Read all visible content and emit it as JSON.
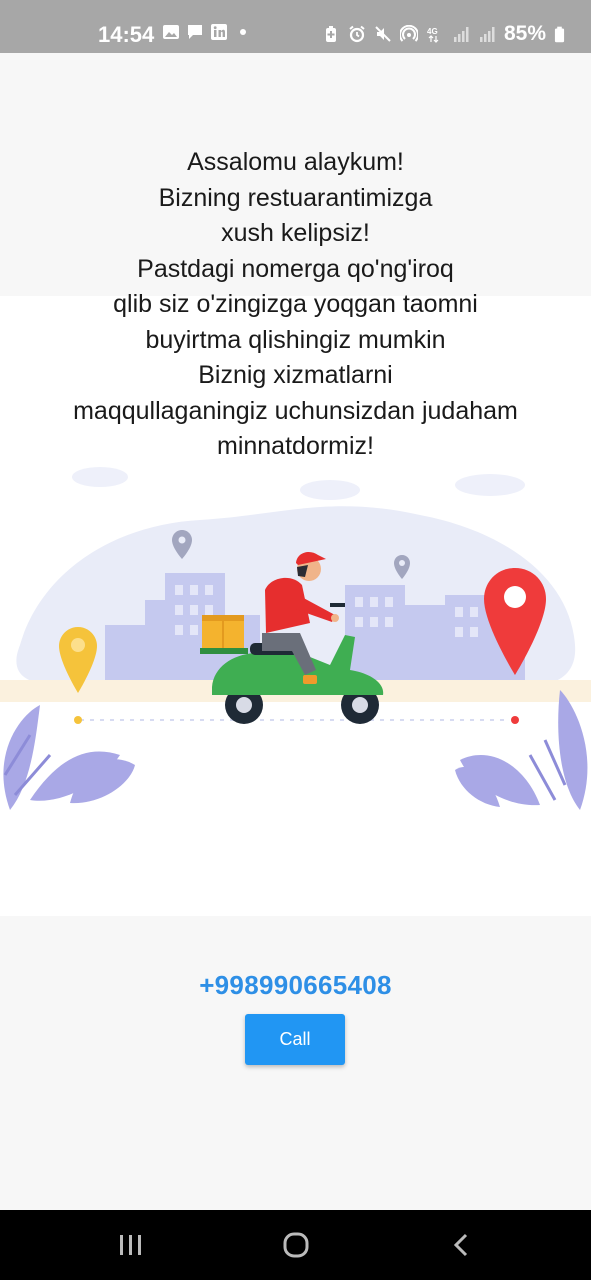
{
  "status_bar": {
    "time": "14:54",
    "battery": "85%",
    "left_icons": [
      "image-icon",
      "chat-icon",
      "linkedin-icon",
      "dot-icon"
    ],
    "right_icons": [
      "battery-saver-icon",
      "alarm-icon",
      "mute-icon",
      "hotspot-icon",
      "4g-icon",
      "signal-icon",
      "signal-icon-2",
      "battery-icon"
    ],
    "network_label": "4G"
  },
  "greeting": {
    "lines": [
      "Assalomu alaykum!",
      "Bizning restuarantimizga",
      "xush kelipsiz!",
      "Pastdagi nomerga qo'ng'iroq",
      "qlib siz o'zingizga yoqgan taomni",
      "buyirtma qlishingiz mumkin",
      "Biznig xizmatlarni",
      "maqqullaganingiz uchunsizdan judaham",
      "minnatdormiz!"
    ]
  },
  "contact": {
    "phone": "+998990665408",
    "call_label": "Call",
    "accent_color": "#2196f3"
  },
  "nav_bar": {
    "buttons": [
      "recent-apps-icon",
      "home-icon",
      "back-icon"
    ]
  }
}
